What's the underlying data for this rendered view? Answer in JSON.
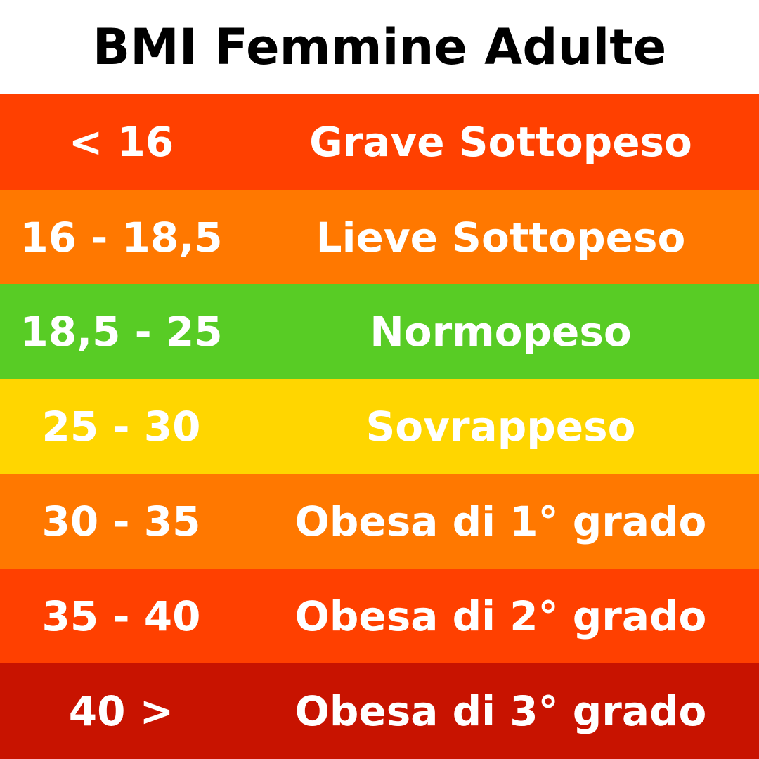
{
  "title": "BMI Femmine Adulte",
  "rows": [
    {
      "range": "< 16",
      "label": "Grave Sottopeso",
      "color": "#FF4000"
    },
    {
      "range": "16 - 18,5",
      "label": "Lieve Sottopeso",
      "color": "#FF7800"
    },
    {
      "range": "18,5 - 25",
      "label": "Normopeso",
      "color": "#58CC25"
    },
    {
      "range": "25 - 30",
      "label": "Sovrappeso",
      "color": "#FFD600"
    },
    {
      "range": "30 - 35",
      "label": "Obesa di 1° grado",
      "color": "#FF7800"
    },
    {
      "range": "35 - 40",
      "label": "Obesa di 2° grado",
      "color": "#FF4000"
    },
    {
      "range": "40 >",
      "label": "Obesa di 3° grado",
      "color": "#C81300"
    }
  ]
}
